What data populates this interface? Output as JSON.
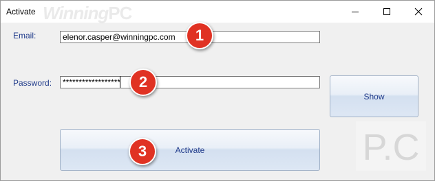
{
  "window": {
    "title": "Activate"
  },
  "watermark": {
    "script": "Winning",
    "big": "PC"
  },
  "titlebar_buttons": [
    "minimize-icon",
    "maximize-icon",
    "close-icon"
  ],
  "form": {
    "email_label": "Email:",
    "email_value": "elenor.casper@winningpc.com",
    "password_label": "Password:",
    "password_value": "******************"
  },
  "buttons": {
    "show": "Show",
    "activate": "Activate"
  },
  "badges": [
    "1",
    "2",
    "3"
  ],
  "logo": {
    "text": "P.C"
  },
  "colors": {
    "badge": "#e03223",
    "label": "#1f3a8a",
    "button_text": "#1f3a8a"
  }
}
